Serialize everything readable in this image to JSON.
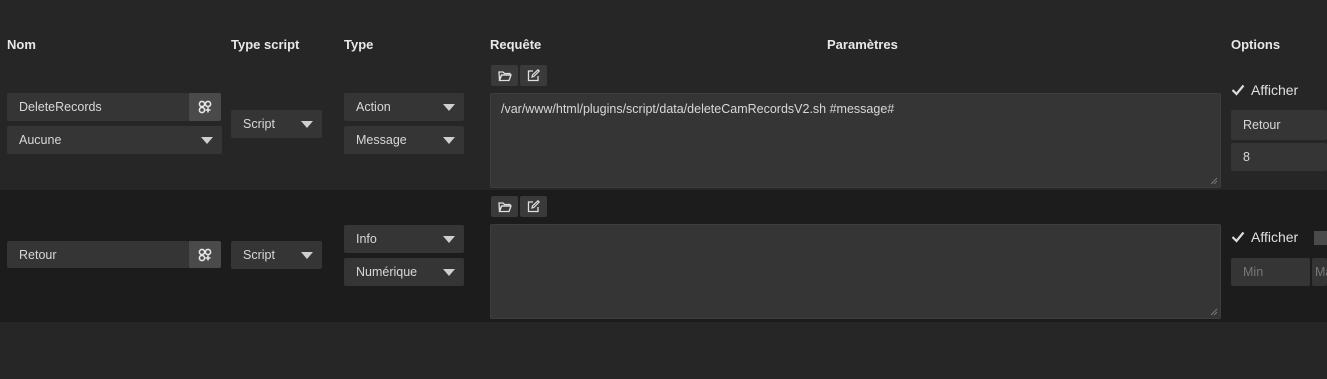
{
  "headers": {
    "nom": "Nom",
    "type_script": "Type script",
    "type": "Type",
    "requete": "Requête",
    "parametres": "Paramètres",
    "options": "Options"
  },
  "rows": [
    {
      "name": "DeleteRecords",
      "name_addon_icon": "config-cog-icon",
      "value_select": "Aucune",
      "script_type": "Script",
      "type": "Action",
      "subtype": "Message",
      "request": "/var/www/html/plugins/script/data/deleteCamRecordsV2.sh  #message#",
      "toolbar_icons": [
        "folder-open-icon",
        "edit-icon"
      ],
      "display_label": "Afficher",
      "display_checked": true,
      "return_select": "Retour",
      "return_value": "8"
    },
    {
      "name": "Retour",
      "name_addon_icon": "config-cog-icon",
      "script_type": "Script",
      "type": "Info",
      "subtype": "Numérique",
      "request": "",
      "toolbar_icons": [
        "folder-open-icon",
        "edit-icon"
      ],
      "display_label": "Afficher",
      "display_checked": true,
      "min_placeholder": "Min",
      "max_placeholder": "Max"
    }
  ]
}
